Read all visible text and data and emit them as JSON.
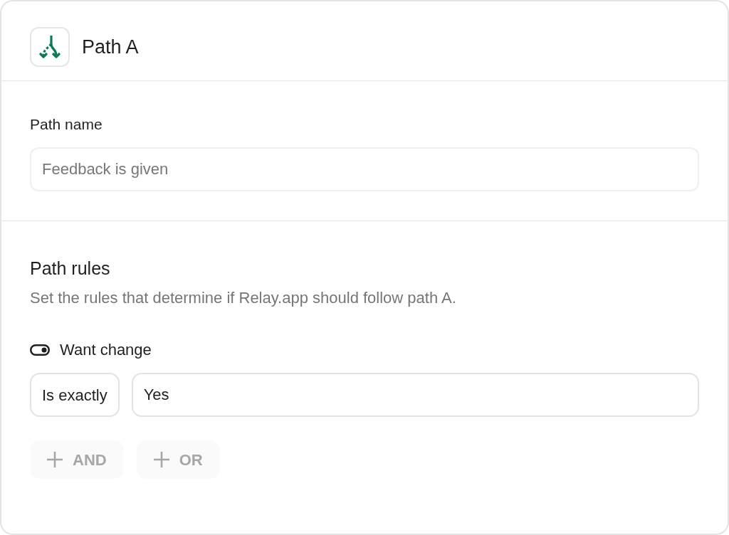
{
  "header": {
    "title": "Path A"
  },
  "path_name": {
    "label": "Path name",
    "placeholder": "Feedback is given"
  },
  "path_rules": {
    "title": "Path rules",
    "description": "Set the rules that determine if Relay.app should follow path A.",
    "conditions": [
      {
        "field": "Want change",
        "operator": "Is exactly",
        "value": "Yes"
      }
    ],
    "buttons": [
      {
        "label": "AND",
        "disabled": true
      },
      {
        "label": "OR",
        "disabled": true
      }
    ]
  }
}
